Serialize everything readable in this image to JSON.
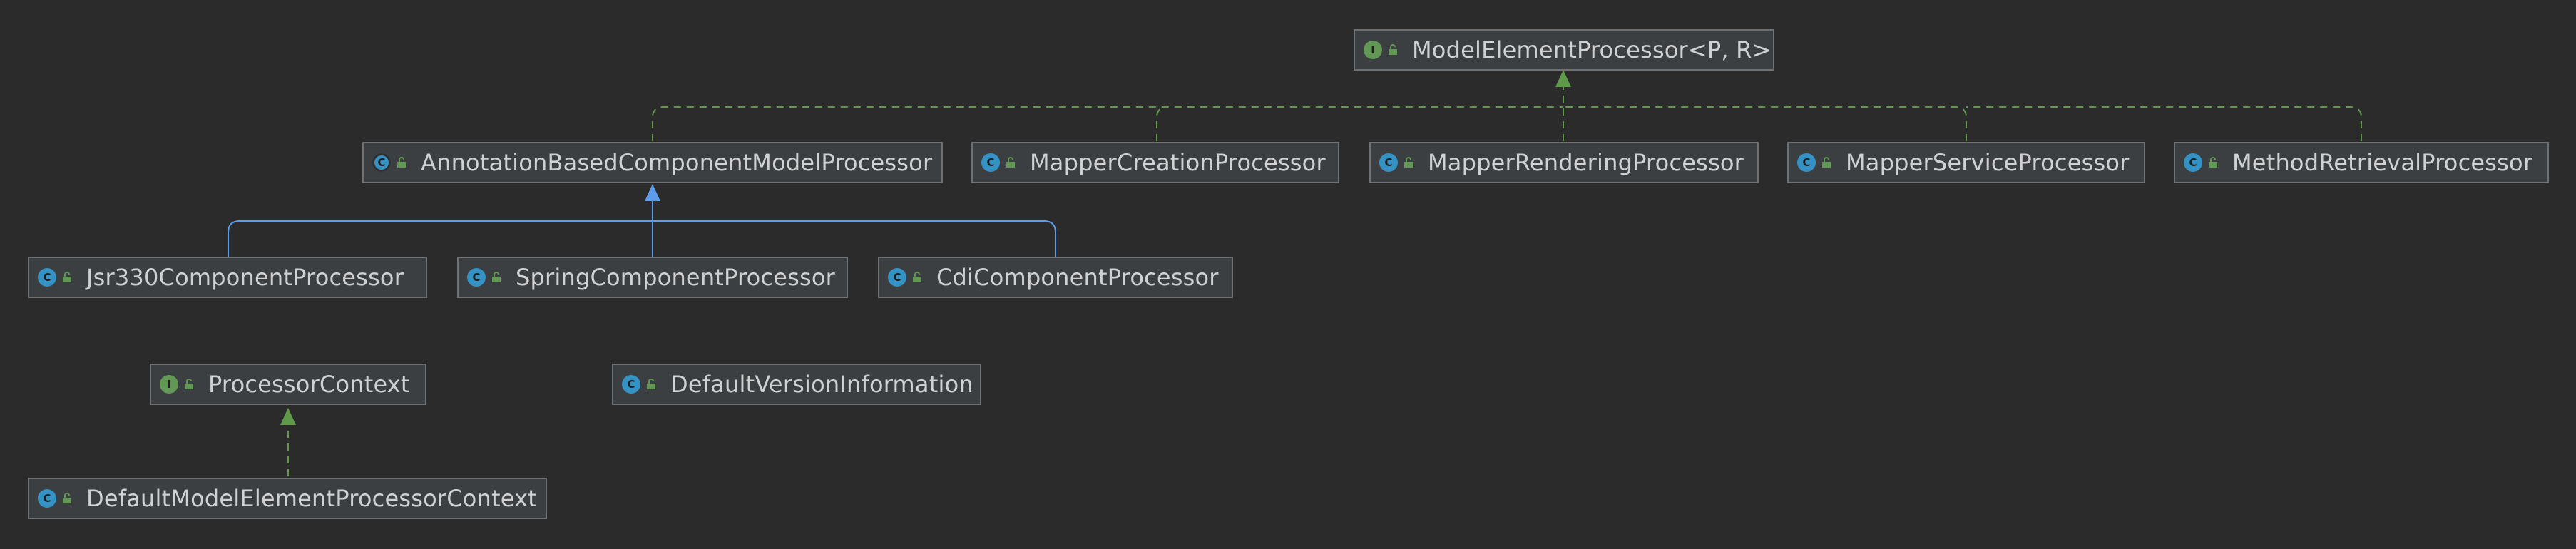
{
  "diagram": {
    "nodes": {
      "model_element_processor": {
        "label": "ModelElementProcessor<P, R>",
        "kind": "interface",
        "icon_letter": "I"
      },
      "annotation_based_component_model_processor": {
        "label": "AnnotationBasedComponentModelProcessor",
        "kind": "abstract-class",
        "icon_letter": "C"
      },
      "mapper_creation_processor": {
        "label": "MapperCreationProcessor",
        "kind": "class",
        "icon_letter": "C"
      },
      "mapper_rendering_processor": {
        "label": "MapperRenderingProcessor",
        "kind": "class",
        "icon_letter": "C"
      },
      "mapper_service_processor": {
        "label": "MapperServiceProcessor",
        "kind": "class",
        "icon_letter": "C"
      },
      "method_retrieval_processor": {
        "label": "MethodRetrievalProcessor",
        "kind": "class",
        "icon_letter": "C"
      },
      "jsr330_component_processor": {
        "label": "Jsr330ComponentProcessor",
        "kind": "class",
        "icon_letter": "C"
      },
      "spring_component_processor": {
        "label": "SpringComponentProcessor",
        "kind": "class",
        "icon_letter": "C"
      },
      "cdi_component_processor": {
        "label": "CdiComponentProcessor",
        "kind": "class",
        "icon_letter": "C"
      },
      "processor_context": {
        "label": "ProcessorContext",
        "kind": "interface",
        "icon_letter": "I"
      },
      "default_version_information": {
        "label": "DefaultVersionInformation",
        "kind": "class",
        "icon_letter": "C"
      },
      "default_model_element_processor_context": {
        "label": "DefaultModelElementProcessorContext",
        "kind": "class",
        "icon_letter": "C"
      }
    },
    "relationships": [
      {
        "from": "annotation_based_component_model_processor",
        "to": "model_element_processor",
        "type": "implements"
      },
      {
        "from": "mapper_creation_processor",
        "to": "model_element_processor",
        "type": "implements"
      },
      {
        "from": "mapper_rendering_processor",
        "to": "model_element_processor",
        "type": "implements"
      },
      {
        "from": "mapper_service_processor",
        "to": "model_element_processor",
        "type": "implements"
      },
      {
        "from": "method_retrieval_processor",
        "to": "model_element_processor",
        "type": "implements"
      },
      {
        "from": "jsr330_component_processor",
        "to": "annotation_based_component_model_processor",
        "type": "extends"
      },
      {
        "from": "spring_component_processor",
        "to": "annotation_based_component_model_processor",
        "type": "extends"
      },
      {
        "from": "cdi_component_processor",
        "to": "annotation_based_component_model_processor",
        "type": "extends"
      },
      {
        "from": "default_model_element_processor_context",
        "to": "processor_context",
        "type": "implements"
      }
    ],
    "colors": {
      "background": "#2b2b2b",
      "node_fill": "#3c3f41",
      "node_border": "#6f7173",
      "label_text": "#cfd1d3",
      "class_icon": "#3592c4",
      "interface_icon": "#629755",
      "implements_edge": "#5f9a4b",
      "extends_edge": "#5c9ceb"
    }
  }
}
